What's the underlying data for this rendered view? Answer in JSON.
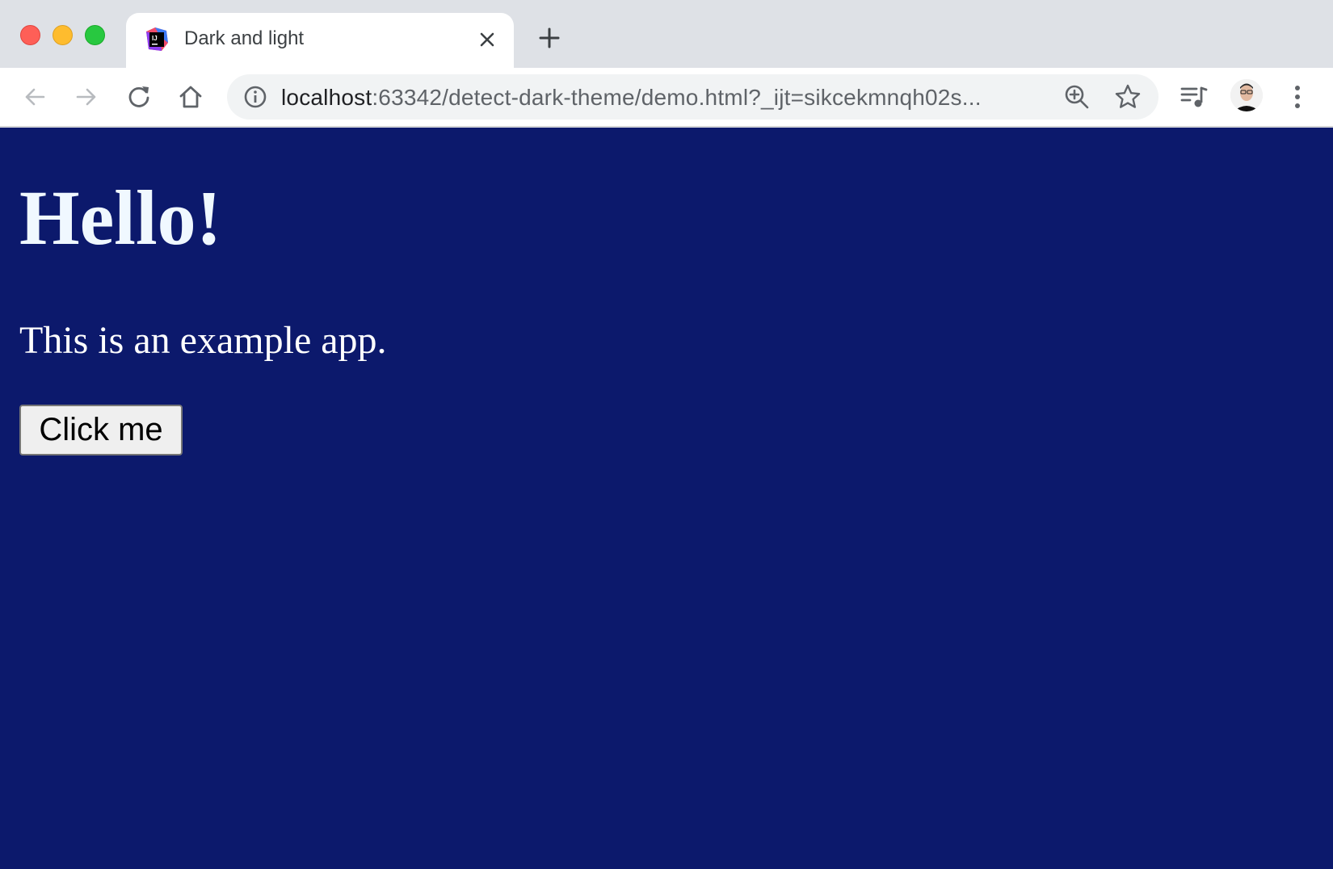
{
  "tab": {
    "title": "Dark and light",
    "favicon": "jetbrains-ij-icon"
  },
  "address_bar": {
    "host": "localhost",
    "path": ":63342/detect-dark-theme/demo.html?_ijt=sikcekmnqh02s..."
  },
  "toolbar_icons": [
    "back-arrow-icon",
    "forward-arrow-icon",
    "reload-icon",
    "home-icon",
    "info-icon",
    "zoom-icon",
    "star-icon",
    "media-queue-icon",
    "avatar",
    "more-menu-icon"
  ],
  "page": {
    "heading": "Hello!",
    "text": "This is an example app.",
    "button_label": "Click me",
    "background_color": "#0c196c",
    "heading_color": "#f0f8ff"
  }
}
